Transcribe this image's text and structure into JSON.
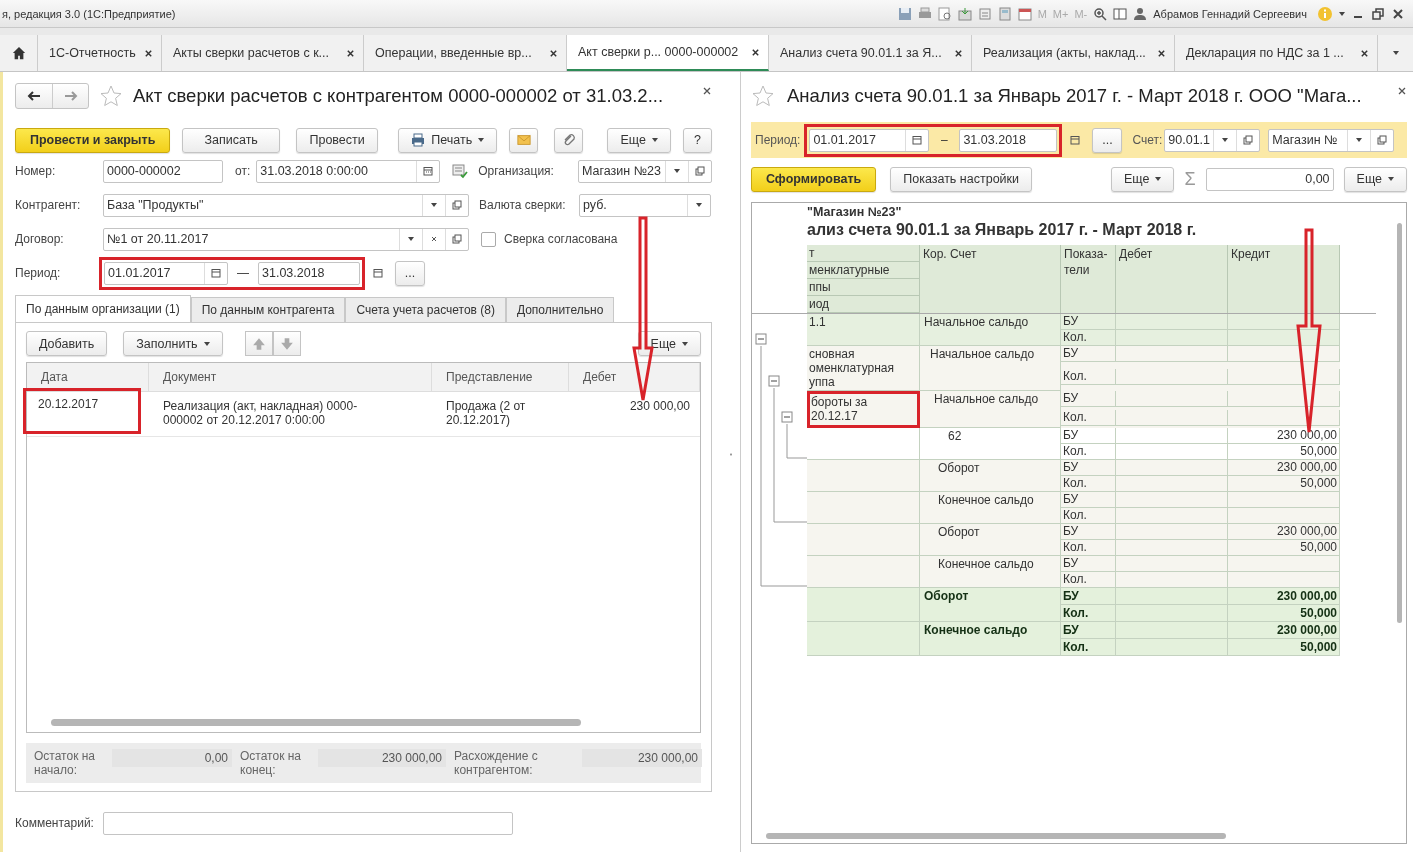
{
  "app_title": "я, редакция 3.0  (1С:Предприятие)",
  "memory_labels": [
    "M",
    "M+",
    "M-"
  ],
  "user": "Абрамов Геннадий Сергеевич",
  "tabs": [
    {
      "label": "1С-Отчетность",
      "selected": false
    },
    {
      "label": "Акты сверки расчетов с к...",
      "selected": false
    },
    {
      "label": "Операции, введенные вр...",
      "selected": false
    },
    {
      "label": "Акт сверки р...  0000-000002",
      "selected": true
    },
    {
      "label": "Анализ счета 90.01.1 за Я...",
      "selected": false
    },
    {
      "label": "Реализация (акты, наклад...",
      "selected": false
    },
    {
      "label": "Декларация по НДС за 1 ...",
      "selected": false
    }
  ],
  "document": {
    "title": "Акт сверки расчетов с контрагентом 0000-000002 от 31.03.2...",
    "buttons": {
      "post_close": "Провести и закрыть",
      "save": "Записать",
      "post": "Провести",
      "print": "Печать",
      "more": "Еще",
      "help": "?"
    },
    "number": {
      "label": "Номер:",
      "value": "0000-000002"
    },
    "date": {
      "label": "от:",
      "value": "31.03.2018  0:00:00"
    },
    "organization": {
      "label": "Организация:",
      "value": "Магазин №23"
    },
    "counterparty": {
      "label": "Контрагент:",
      "value": "База \"Продукты\""
    },
    "currency": {
      "label": "Валюта сверки:",
      "value": "руб."
    },
    "contract": {
      "label": "Договор:",
      "value": "№1 от 20.11.2017"
    },
    "agreed": {
      "label": "Сверка согласована",
      "checked": false
    },
    "period": {
      "label": "Период:",
      "from": "01.01.2017",
      "separator": "—",
      "to": "31.03.2018",
      "highlighted": true,
      "more": "..."
    },
    "tabs": [
      {
        "label": "По данным организации (1)",
        "selected": true
      },
      {
        "label": "По данным контрагента",
        "selected": false
      },
      {
        "label": "Счета учета расчетов (8)",
        "selected": false
      },
      {
        "label": "Дополнительно",
        "selected": false
      }
    ],
    "table_toolbar": {
      "add": "Добавить",
      "fill": "Заполнить",
      "more": "Еще"
    },
    "columns": [
      "Дата",
      "Документ",
      "Представление",
      "Дебет"
    ],
    "rows": [
      {
        "date": "20.12.2017",
        "highlighted": true,
        "document": "Реализация (акт, накладная) 0000-000002 от 20.12.2017 0:00:00",
        "representation": "Продажа (2 от 20.12.2017)",
        "debit": "230 000,00"
      }
    ],
    "totals": [
      {
        "label": "Остаток на начало:",
        "value": "0,00"
      },
      {
        "label": "Остаток на конец:",
        "value": "230 000,00"
      },
      {
        "label": "Расхождение с контрагентом:",
        "value": "230 000,00"
      }
    ],
    "comment": {
      "label": "Комментарий:"
    }
  },
  "report": {
    "title": "Анализ счета 90.01.1 за Январь 2017 г. - Март 2018 г. ООО \"Мага...",
    "period": {
      "label": "Период:",
      "from": "01.01.2017",
      "separator": "–",
      "to": "31.03.2018",
      "highlighted": true,
      "more": "..."
    },
    "account": {
      "label": "Счет:",
      "value": "90.01.1"
    },
    "organization": "Магазин №",
    "buttons": {
      "generate": "Сформировать",
      "settings": "Показать настройки",
      "more": "Еще",
      "sum_symbol": "Σ",
      "sum_value": "0,00",
      "more_right": "Еще"
    },
    "org_line": "\"Магазин №23\"",
    "heading": "ализ счета 90.01.1 за Январь 2017 г. - Март 2018 г.",
    "header_col1": [
      "т",
      "менклатурные",
      "ппы",
      "иод"
    ],
    "columns": [
      "Кор. Счет",
      "Показа-тели",
      "Дебет",
      "Кредит"
    ],
    "groups": [
      {
        "kind": "account",
        "name": "1.1",
        "kor": "Начальное сальдо",
        "lines": [
          {
            "indicator": "БУ"
          },
          {
            "indicator": "Кол."
          }
        ]
      },
      {
        "kind": "group",
        "name": "сновная оменклатурная уппа",
        "kor": "Начальное сальдо",
        "lines": [
          {
            "indicator": "БУ"
          },
          {
            "indicator": "Кол."
          }
        ]
      },
      {
        "kind": "period",
        "name": "бороты за 20.12.17",
        "highlighted": true,
        "kor": "Начальное сальдо",
        "lines": [
          {
            "indicator": "БУ"
          },
          {
            "indicator": "Кол."
          }
        ]
      },
      {
        "kind": "detail",
        "kor": "62",
        "lines": [
          {
            "indicator": "БУ",
            "credit": "230 000,00"
          },
          {
            "indicator": "Кол.",
            "credit": "50,000"
          }
        ]
      },
      {
        "kind": "subtotal",
        "kor": "Оборот",
        "lines": [
          {
            "indicator": "БУ",
            "credit": "230 000,00"
          },
          {
            "indicator": "Кол.",
            "credit": "50,000"
          }
        ]
      },
      {
        "kind": "subtotal",
        "kor": "Конечное сальдо",
        "lines": [
          {
            "indicator": "БУ"
          },
          {
            "indicator": "Кол."
          }
        ]
      },
      {
        "kind": "subtotal",
        "kor": "Оборот",
        "lines": [
          {
            "indicator": "БУ",
            "credit": "230 000,00"
          },
          {
            "indicator": "Кол.",
            "credit": "50,000"
          }
        ]
      },
      {
        "kind": "subtotal",
        "kor": "Конечное сальдо",
        "lines": [
          {
            "indicator": "БУ"
          },
          {
            "indicator": "Кол."
          }
        ]
      },
      {
        "kind": "total",
        "kor": "Оборот",
        "lines": [
          {
            "indicator": "БУ",
            "credit": "230 000,00"
          },
          {
            "indicator": "Кол.",
            "credit": "50,000"
          }
        ]
      },
      {
        "kind": "total",
        "kor": "Конечное сальдо",
        "lines": [
          {
            "indicator": "БУ",
            "credit": "230 000,00"
          },
          {
            "indicator": "Кол.",
            "credit": "50,000"
          }
        ]
      }
    ]
  }
}
